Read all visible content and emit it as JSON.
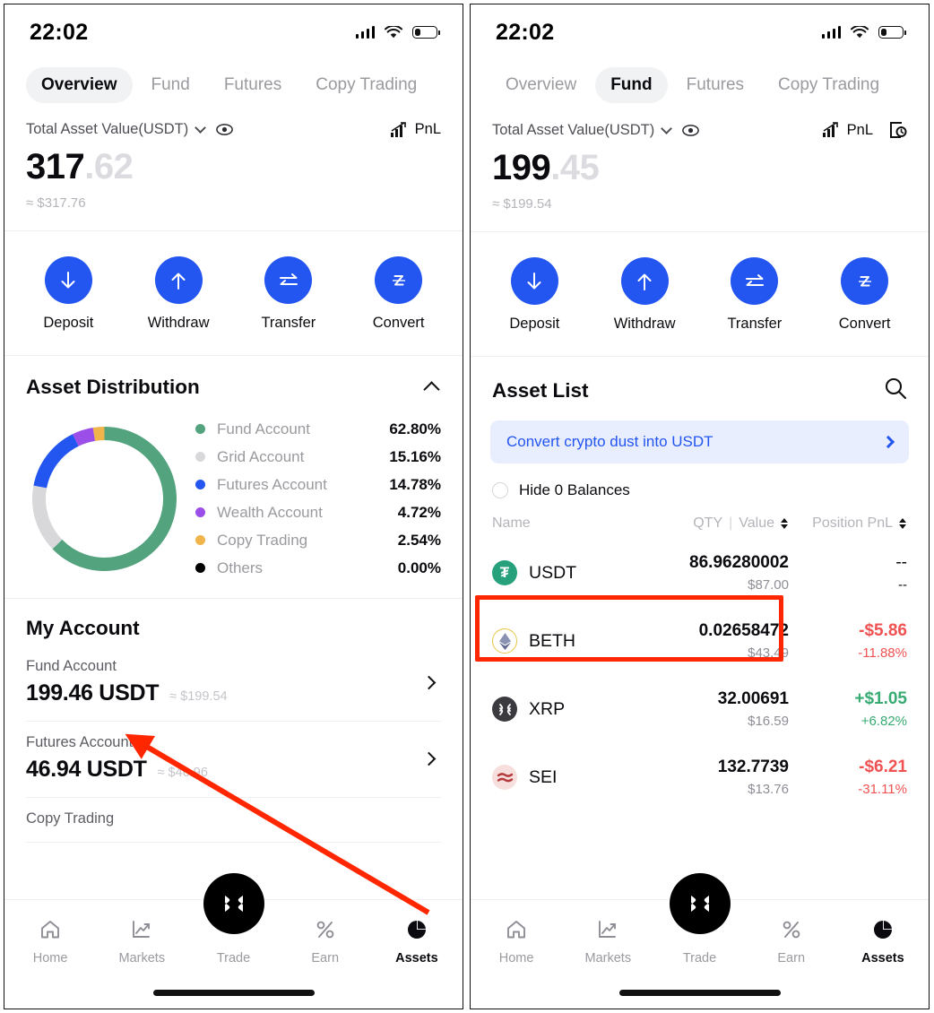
{
  "status_bar": {
    "time": "22:02",
    "signal_icon": "cellular-signal-icon",
    "wifi_icon": "wifi-icon",
    "battery_icon": "battery-icon"
  },
  "tabs": [
    {
      "label": "Overview"
    },
    {
      "label": "Fund"
    },
    {
      "label": "Futures"
    },
    {
      "label": "Copy Trading"
    }
  ],
  "left_panel": {
    "active_tab": "Overview",
    "total": {
      "label": "Total Asset Value(USDT)",
      "int": "317",
      "dec": ".62",
      "approx": "≈ $317.76",
      "pnl_label": "PnL",
      "chevron_icon": "chevron-down-icon",
      "eye_icon": "eye-icon",
      "pnl_icon": "pnl-chart-icon"
    },
    "actions": [
      {
        "label": "Deposit",
        "icon": "arrow-down-icon"
      },
      {
        "label": "Withdraw",
        "icon": "arrow-up-icon"
      },
      {
        "label": "Transfer",
        "icon": "transfer-arrows-icon"
      },
      {
        "label": "Convert",
        "icon": "convert-z-icon"
      }
    ],
    "distribution": {
      "title": "Asset Distribution",
      "collapse_icon": "chevron-up-icon",
      "legend": [
        {
          "name": "Fund Account",
          "pct": "62.80%",
          "color": "#52a37e",
          "value": 62.8
        },
        {
          "name": "Grid Account",
          "pct": "15.16%",
          "color": "#d8d8da",
          "value": 15.16
        },
        {
          "name": "Futures Account",
          "pct": "14.78%",
          "color": "#2355f0",
          "value": 14.78
        },
        {
          "name": "Wealth Account",
          "pct": "4.72%",
          "color": "#9b4fe8",
          "value": 4.72
        },
        {
          "name": "Copy Trading",
          "pct": "2.54%",
          "color": "#f0b44a",
          "value": 2.54
        },
        {
          "name": "Others",
          "pct": "0.00%",
          "color": "#000000",
          "value": 0.0
        }
      ]
    },
    "my_account": {
      "title": "My Account",
      "rows": [
        {
          "name": "Fund Account",
          "amount": "199.46 USDT",
          "usd": "≈ $199.54"
        },
        {
          "name": "Futures Account",
          "amount": "46.94 USDT",
          "usd": "≈ $46.96"
        },
        {
          "name": "Copy Trading",
          "amount": "",
          "usd": ""
        }
      ]
    }
  },
  "right_panel": {
    "active_tab": "Fund",
    "total": {
      "label": "Total Asset Value(USDT)",
      "int": "199",
      "dec": ".45",
      "approx": "≈ $199.54",
      "pnl_label": "PnL",
      "chevron_icon": "chevron-down-icon",
      "eye_icon": "eye-icon",
      "pnl_icon": "pnl-chart-icon",
      "history_icon": "transaction-history-icon"
    },
    "actions": [
      {
        "label": "Deposit",
        "icon": "arrow-down-icon"
      },
      {
        "label": "Withdraw",
        "icon": "arrow-up-icon"
      },
      {
        "label": "Transfer",
        "icon": "transfer-arrows-icon"
      },
      {
        "label": "Convert",
        "icon": "convert-z-icon"
      }
    ],
    "asset_list": {
      "title": "Asset List",
      "search_icon": "search-icon",
      "dust_banner": {
        "text": "Convert crypto dust into USDT",
        "chevron_icon": "chevron-right-icon"
      },
      "hide_zero": {
        "label": "Hide 0 Balances",
        "checked": false
      },
      "columns": {
        "name": "Name",
        "qty": "QTY",
        "value": "Value",
        "pnl": "Position PnL"
      },
      "rows": [
        {
          "symbol": "USDT",
          "qty": "86.96280002",
          "usd": "$87.00",
          "pnl": "--",
          "pnl_pct": "--",
          "trend": "neutral",
          "coin_bg": "#26a17b",
          "coin_fg": "#ffffff",
          "coin_glyph": "₮"
        },
        {
          "symbol": "BETH",
          "qty": "0.02658472",
          "usd": "$43.49",
          "pnl": "-$5.86",
          "pnl_pct": "-11.88%",
          "trend": "down",
          "coin_bg": "#ffffff",
          "coin_fg": "#8a92b2",
          "coin_glyph": "◆"
        },
        {
          "symbol": "XRP",
          "qty": "32.00691",
          "usd": "$16.59",
          "pnl": "+$1.05",
          "pnl_pct": "+6.82%",
          "trend": "up",
          "coin_bg": "#3b3b3f",
          "coin_fg": "#ffffff",
          "coin_glyph": "✕"
        },
        {
          "symbol": "SEI",
          "qty": "132.7739",
          "usd": "$13.76",
          "pnl": "-$6.21",
          "pnl_pct": "-31.11%",
          "trend": "down",
          "coin_bg": "#f6dfdc",
          "coin_fg": "#b33a3a",
          "coin_glyph": "≋"
        }
      ]
    }
  },
  "bottom_nav": [
    {
      "label": "Home",
      "icon": "home-icon",
      "active": false
    },
    {
      "label": "Markets",
      "icon": "markets-icon",
      "active": false
    },
    {
      "label": "Trade",
      "icon": "trade-icon",
      "active": false
    },
    {
      "label": "Earn",
      "icon": "percent-icon",
      "active": false
    },
    {
      "label": "Assets",
      "icon": "pie-icon",
      "active": true
    }
  ],
  "annotations": {
    "highlight_box_color": "#ff2600",
    "arrow_color": "#ff2600",
    "arrow_from": "assets-tab",
    "arrow_to": "fund-account-row"
  }
}
